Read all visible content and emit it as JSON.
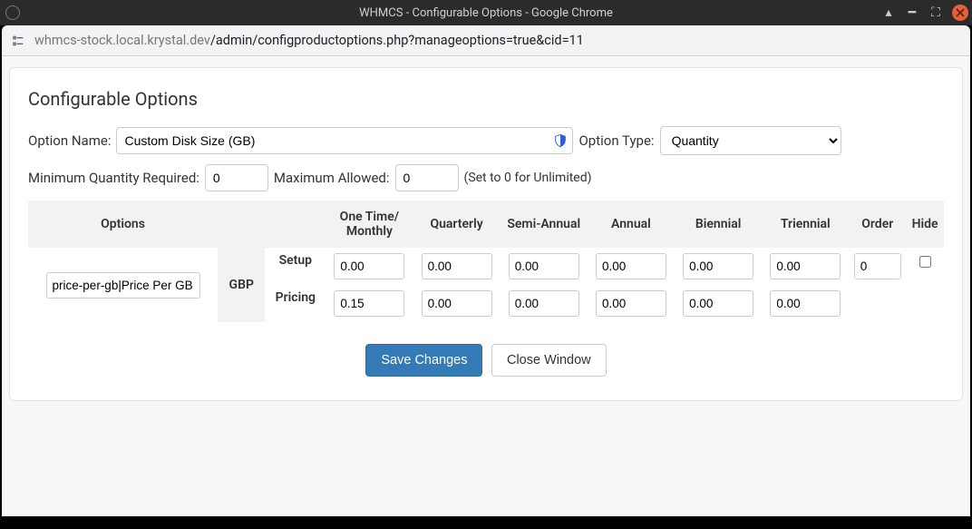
{
  "window": {
    "title": "WHMCS - Configurable Options - Google Chrome",
    "url_host": "whmcs-stock.local.krystal.dev",
    "url_path": "/admin/configproductoptions.php?manageoptions=true&cid=11"
  },
  "page": {
    "heading": "Configurable Options",
    "labels": {
      "option_name": "Option Name:",
      "option_type": "Option Type:",
      "min_qty": "Minimum Quantity Required:",
      "max_allowed": "Maximum Allowed:",
      "zero_hint": "(Set to 0 for Unlimited)"
    },
    "fields": {
      "option_name": "Custom Disk Size (GB)",
      "option_type_selected": "Quantity",
      "option_type_options": [
        "Quantity"
      ],
      "min_qty": "0",
      "max_allowed": "0"
    }
  },
  "table": {
    "columns": {
      "options": "Options",
      "onetime": "One Time/\nMonthly",
      "quarterly": "Quarterly",
      "semiannual": "Semi-Annual",
      "annual": "Annual",
      "biennial": "Biennial",
      "triennial": "Triennial",
      "order": "Order",
      "hide": "Hide"
    },
    "currency": "GBP",
    "rows": {
      "setup_label": "Setup",
      "pricing_label": "Pricing",
      "option_value": "price-per-gb|Price Per GB",
      "setup": {
        "onetime": "0.00",
        "quarterly": "0.00",
        "semiannual": "0.00",
        "annual": "0.00",
        "biennial": "0.00",
        "triennial": "0.00"
      },
      "pricing": {
        "onetime": "0.15",
        "quarterly": "0.00",
        "semiannual": "0.00",
        "annual": "0.00",
        "biennial": "0.00",
        "triennial": "0.00"
      },
      "order": "0",
      "hide_checked": false
    }
  },
  "buttons": {
    "save": "Save Changes",
    "close": "Close Window"
  }
}
